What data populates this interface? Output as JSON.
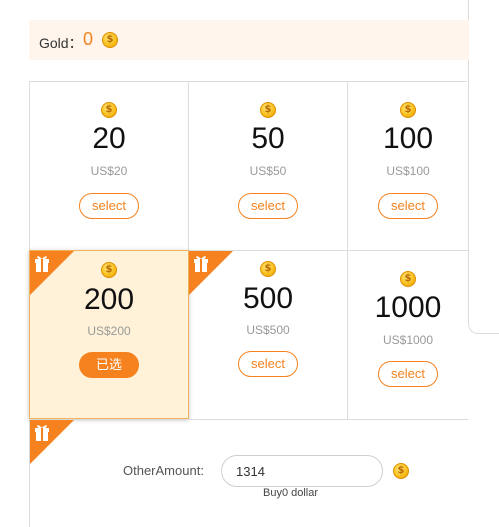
{
  "gold": {
    "label": "Gold：",
    "value": "0"
  },
  "packages_row1": [
    {
      "amount": "20",
      "price": "US$20",
      "button": "select"
    },
    {
      "amount": "50",
      "price": "US$50",
      "button": "select"
    },
    {
      "amount": "100",
      "price": "US$100",
      "button": "select"
    }
  ],
  "packages_row2": [
    {
      "amount": "200",
      "price": "US$200",
      "button": "已选",
      "selected": true
    },
    {
      "amount": "500",
      "price": "US$500",
      "button": "select"
    },
    {
      "amount": "1000",
      "price": "US$1000",
      "button": "select"
    }
  ],
  "other": {
    "label": "OtherAmount:",
    "value": "1314",
    "note": "Buy0 dollar"
  },
  "icons": {
    "coin": "dollar-coin-icon",
    "gift": "gift-icon"
  },
  "colors": {
    "accent": "#f5821f",
    "selected_bg": "#fff2d9",
    "gold_bar_bg": "#fff5ec"
  }
}
